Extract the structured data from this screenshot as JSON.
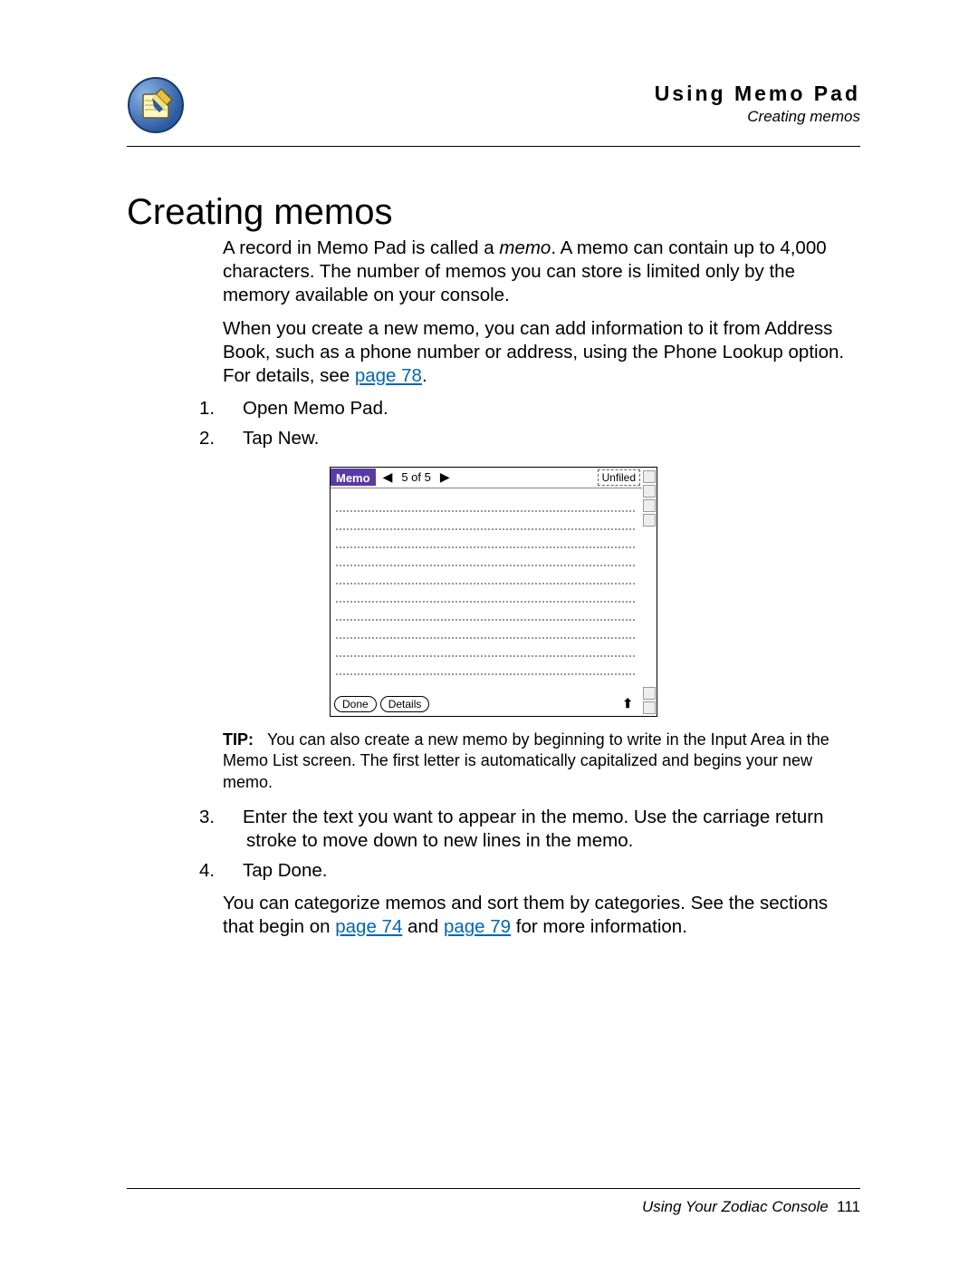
{
  "header": {
    "title": "Using Memo Pad",
    "subtitle": "Creating memos"
  },
  "section_title": "Creating memos",
  "intro": {
    "p1_a": "A record in Memo Pad is called a ",
    "p1_memo": "memo",
    "p1_b": ". A memo can contain up to 4,000 characters. The number of memos you can store is limited only by the memory available on your console.",
    "p2_a": "When you create a new memo, you can add information to it from Address Book, such as a phone number or address, using the Phone Lookup option. For details, see ",
    "p2_link": "page 78",
    "p2_b": "."
  },
  "steps_top": [
    "Open Memo Pad.",
    "Tap New."
  ],
  "screenshot": {
    "memo_label": "Memo",
    "counter": "5 of 5",
    "category": "Unfiled",
    "done": "Done",
    "details": "Details"
  },
  "tip": {
    "label": "TIP:",
    "text": "You can also create a new memo by beginning to write in the Input Area in the Memo List screen. The first letter is automatically capitalized and begins your new memo."
  },
  "steps_bottom": [
    "Enter the text you want to appear in the memo. Use the carriage return stroke to move down to new lines in the memo.",
    "Tap Done."
  ],
  "closing": {
    "a": "You can categorize memos and sort them by categories. See the sections that begin on ",
    "link1": "page 74",
    "mid": " and ",
    "link2": "page 79",
    "b": " for more information."
  },
  "footer": {
    "text": "Using Your Zodiac Console",
    "page": "111"
  }
}
